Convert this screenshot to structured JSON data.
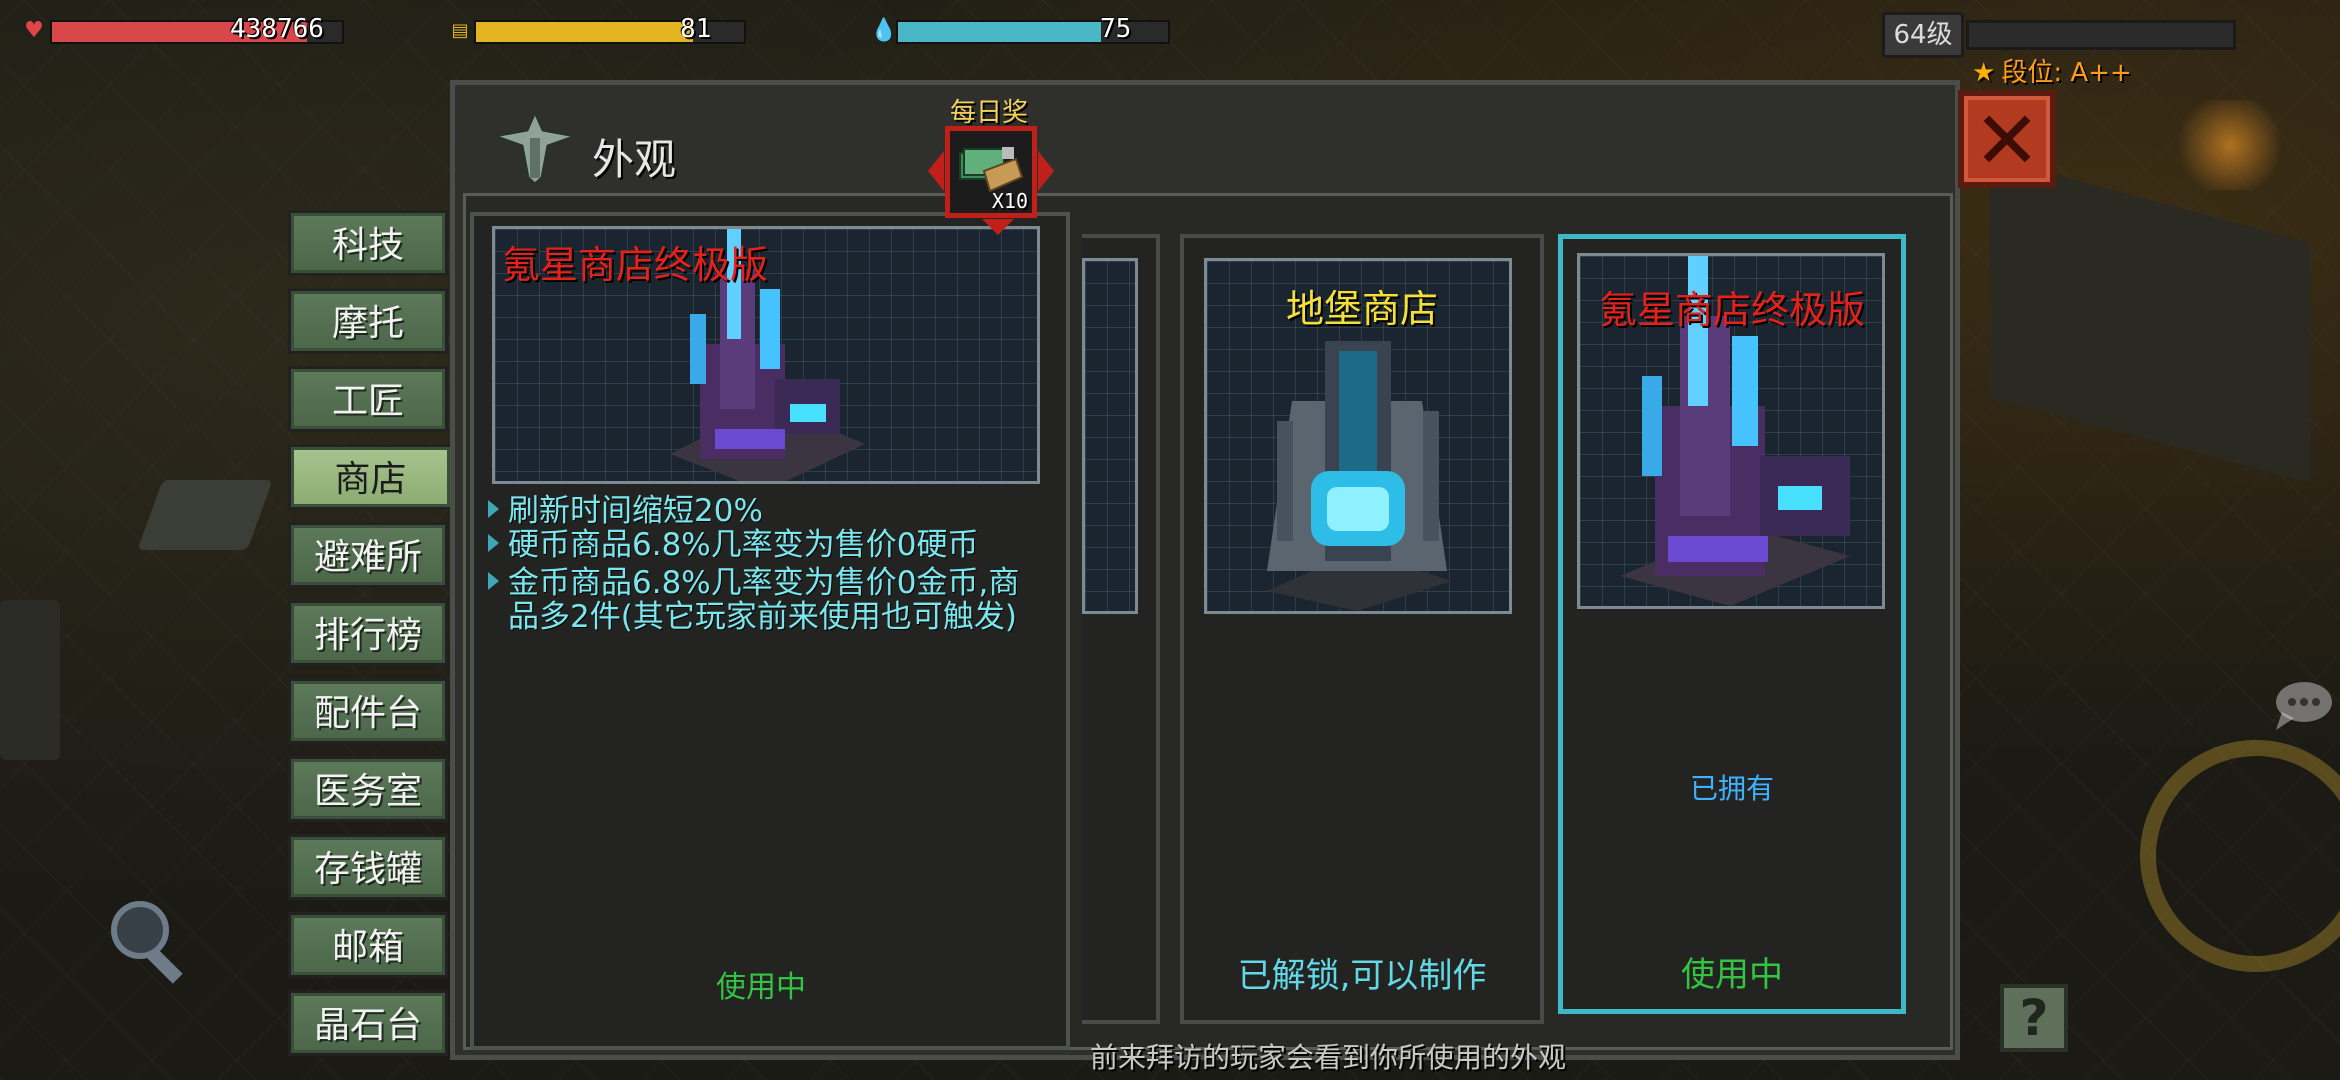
{
  "hud": {
    "health": {
      "value": "438766",
      "fill": 0.88,
      "color": "#d9474a",
      "icon": "heart-icon"
    },
    "food": {
      "value": "81",
      "fill": 0.81,
      "color": "#e4b420",
      "icon": "food-icon"
    },
    "water": {
      "value": "75",
      "fill": 0.75,
      "color": "#4ab6c6",
      "icon": "water-drop-icon"
    },
    "level": "64级",
    "exp_fill": 0.0,
    "rank": "段位: A++"
  },
  "sidebar": {
    "items": [
      {
        "label": "科技",
        "active": false
      },
      {
        "label": "摩托",
        "active": false
      },
      {
        "label": "工匠",
        "active": false
      },
      {
        "label": "商店",
        "active": true
      },
      {
        "label": "避难所",
        "active": false
      },
      {
        "label": "排行榜",
        "active": false
      },
      {
        "label": "配件台",
        "active": false
      },
      {
        "label": "医务室",
        "active": false
      },
      {
        "label": "存钱罐",
        "active": false
      },
      {
        "label": "邮箱",
        "active": false
      },
      {
        "label": "晶石台",
        "active": false
      }
    ]
  },
  "panel": {
    "title": "外观",
    "daily_reward": {
      "label": "每日奖",
      "quantity": "X10"
    }
  },
  "detail": {
    "name": "氪星商店终极版",
    "effects": [
      "刷新时间缩短20%",
      "硬币商品6.8%几率变为售价0硬币",
      "金币商品6.8%几率变为售价0金币,商",
      "品多2件(其它玩家前来使用也可触发)"
    ],
    "status": "使用中"
  },
  "skins": [
    {
      "name": "地堡商店",
      "name_color": "#f5e03a",
      "owned_label": "",
      "status": "已解锁,可以制作",
      "status_color": "#62d9e6",
      "selected": false
    },
    {
      "name": "氪星商店终极版",
      "name_color": "#e5211c",
      "owned_label": "已拥有",
      "status": "使用中",
      "status_color": "#32c442",
      "selected": true
    }
  ],
  "hint": "前来拜访的玩家会看到你所使用的外观",
  "help_label": "?",
  "close_label": "✕"
}
